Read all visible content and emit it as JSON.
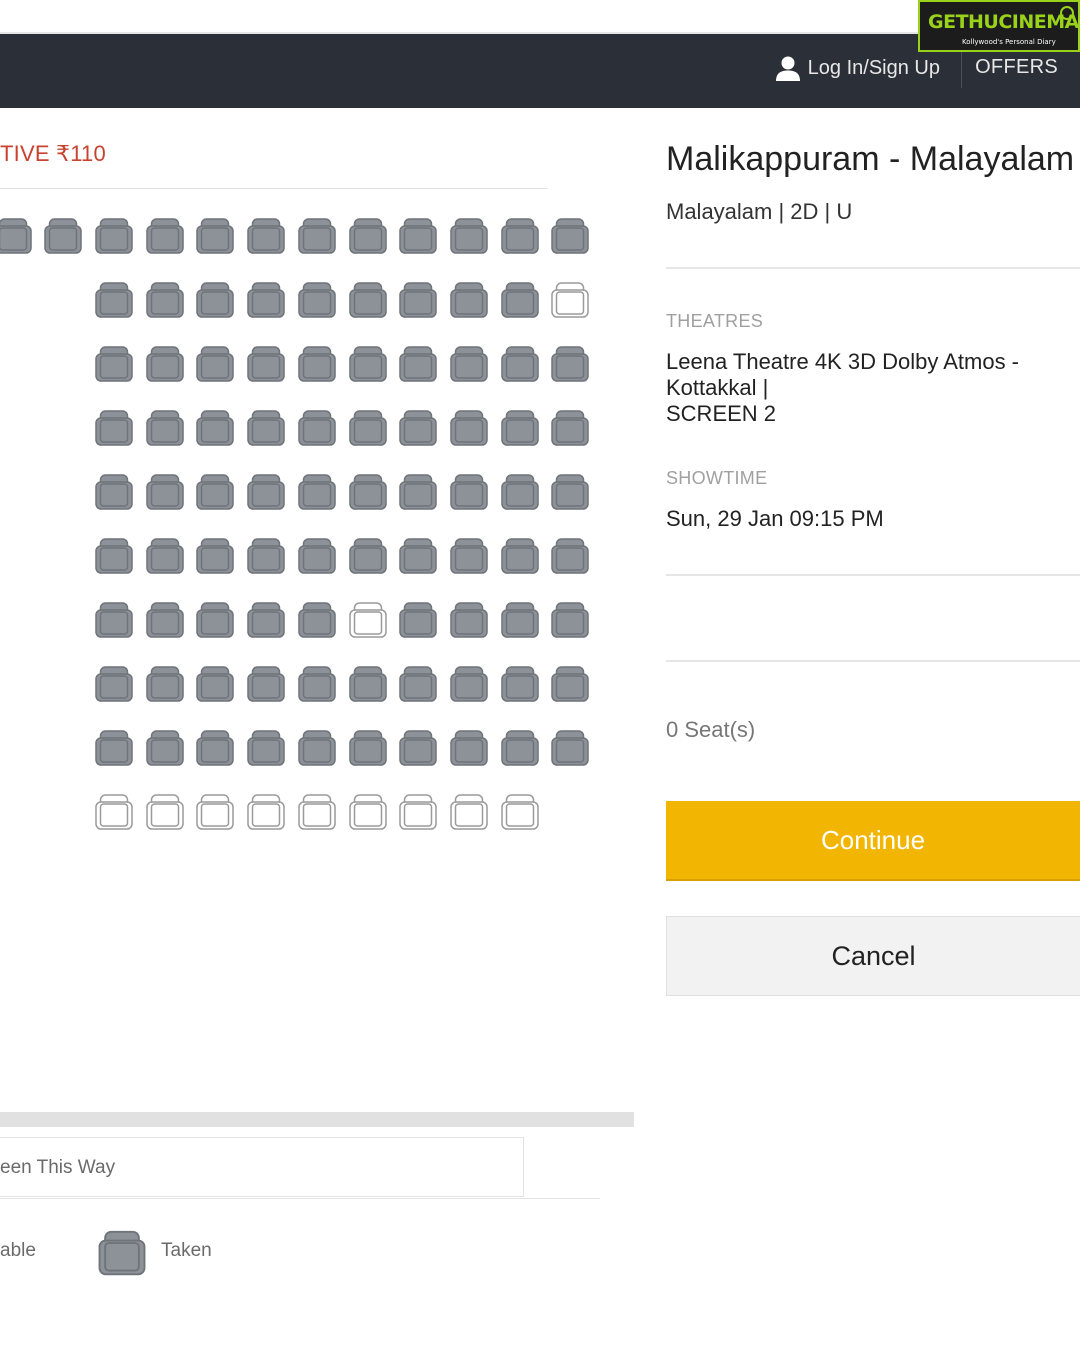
{
  "nav": {
    "login_label": "Log In/Sign Up",
    "offers_label": "OFFERS",
    "user_icon": "user-icon"
  },
  "watermark": {
    "text": "GETHUCINEMA",
    "tagline": "Kollywood's Personal Diary"
  },
  "seat_layout": {
    "price_header": "TIVE ₹110",
    "rows": [
      [
        "taken",
        "taken",
        "taken",
        "taken",
        "taken",
        "taken",
        "taken",
        "taken",
        "taken",
        "taken",
        "taken",
        "taken"
      ],
      [
        "taken",
        "taken",
        "taken",
        "taken",
        "taken",
        "taken",
        "taken",
        "taken",
        "taken",
        "available"
      ],
      [
        "taken",
        "taken",
        "taken",
        "taken",
        "taken",
        "taken",
        "taken",
        "taken",
        "taken",
        "taken"
      ],
      [
        "taken",
        "taken",
        "taken",
        "taken",
        "taken",
        "taken",
        "taken",
        "taken",
        "taken",
        "taken"
      ],
      [
        "taken",
        "taken",
        "taken",
        "taken",
        "taken",
        "taken",
        "taken",
        "taken",
        "taken",
        "taken"
      ],
      [
        "taken",
        "taken",
        "taken",
        "taken",
        "taken",
        "taken",
        "taken",
        "taken",
        "taken",
        "taken"
      ],
      [
        "taken",
        "taken",
        "taken",
        "taken",
        "taken",
        "available",
        "taken",
        "taken",
        "taken",
        "taken"
      ],
      [
        "taken",
        "taken",
        "taken",
        "taken",
        "taken",
        "taken",
        "taken",
        "taken",
        "taken",
        "taken"
      ],
      [
        "taken",
        "taken",
        "taken",
        "taken",
        "taken",
        "taken",
        "taken",
        "taken",
        "taken",
        "taken"
      ],
      [
        "available",
        "available",
        "available",
        "available",
        "available",
        "available",
        "available",
        "available",
        "available"
      ]
    ],
    "screen_label": "een This Way",
    "legend": {
      "available_label": "able",
      "taken_label": "Taken"
    }
  },
  "summary": {
    "movie_title": "Malikappuram - Malayalam",
    "movie_meta": "Malayalam | 2D | U",
    "theatres_label": "THEATRES",
    "theatre_line1": "Leena Theatre 4K 3D Dolby Atmos -",
    "theatre_line2": "Kottakkal |",
    "theatre_line3": "SCREEN 2",
    "showtime_label": "SHOWTIME",
    "showtime": "Sun, 29 Jan 09:15 PM",
    "seat_count": "0 Seat(s)",
    "continue_label": "Continue",
    "cancel_label": "Cancel"
  },
  "colors": {
    "nav_bg": "#2b2f37",
    "accent_price": "#c8432f",
    "continue_bg": "#f1b502",
    "seat_taken": "#8d9198",
    "seat_available_border": "#9a9a9a"
  }
}
